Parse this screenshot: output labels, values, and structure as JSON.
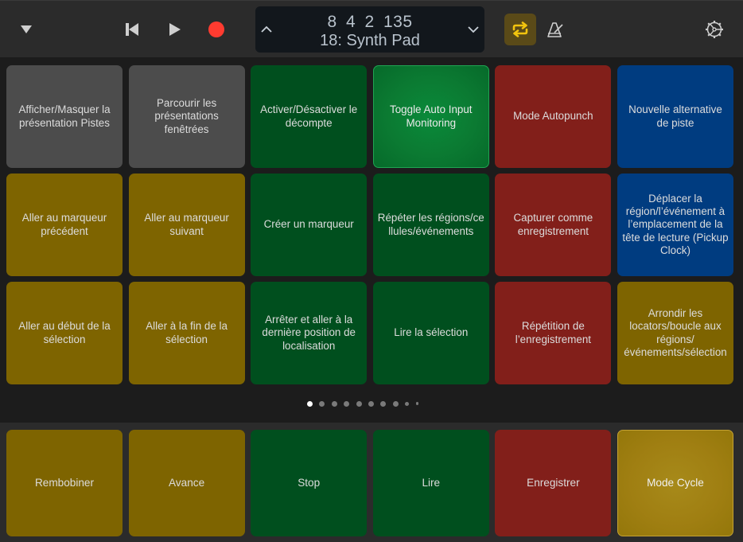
{
  "control_bar": {
    "menu_icon": "triangle-down-icon",
    "transport": {
      "go_to_start_icon": "skip-back-icon",
      "play_icon": "play-icon",
      "record_icon": "record-icon",
      "record_color": "#ff3b30"
    },
    "lcd": {
      "position": "8 4 2 135",
      "track_name": "18: Synth Pad",
      "prev_icon": "chevron-up-icon",
      "next_icon": "chevron-down-icon"
    },
    "cycle": {
      "icon": "cycle-icon",
      "active": true,
      "color": "#f2c40e"
    },
    "metronome_icon": "metronome-icon",
    "settings_icon": "gear-icon"
  },
  "pads": [
    {
      "label": "Afficher/Masquer la présentation Pistes",
      "color": "gray"
    },
    {
      "label": "Parcourir les présentations fenêtrées",
      "color": "gray"
    },
    {
      "label": "Activer/Désactiver le décompte",
      "color": "green"
    },
    {
      "label": "Toggle Auto Input Monitoring",
      "color": "green",
      "active": true
    },
    {
      "label": "Mode Autopunch",
      "color": "red"
    },
    {
      "label": "Nouvelle alternative de piste",
      "color": "blue"
    },
    {
      "label": "Aller au marqueur précédent",
      "color": "yellow"
    },
    {
      "label": "Aller au marqueur suivant",
      "color": "yellow"
    },
    {
      "label": "Créer un marqueur",
      "color": "green"
    },
    {
      "label": "Répéter les régions/cellules/événements",
      "color": "green"
    },
    {
      "label": "Capturer comme enregistrement",
      "color": "red"
    },
    {
      "label": "Déplacer la région/l’événement à l’emplacement de la tête de lecture (Pickup Clock)",
      "color": "blue"
    },
    {
      "label": "Aller au début de la sélection",
      "color": "yellow"
    },
    {
      "label": "Aller à la fin de la sélection",
      "color": "yellow"
    },
    {
      "label": "Arrêter et aller à la dernière position de localisation",
      "color": "green"
    },
    {
      "label": "Lire la sélection",
      "color": "green"
    },
    {
      "label": "Répétition de l’enregistrement",
      "color": "red"
    },
    {
      "label": "Arrondir les locators/boucle aux régions/événements/sélection",
      "color": "yellow"
    }
  ],
  "pager": {
    "page_count": 10,
    "current_page": 1
  },
  "transport_pads": [
    {
      "label": "Rembobiner",
      "color": "yellow"
    },
    {
      "label": "Avance",
      "color": "yellow"
    },
    {
      "label": "Stop",
      "color": "green"
    },
    {
      "label": "Lire",
      "color": "green"
    },
    {
      "label": "Enregistrer",
      "color": "red"
    },
    {
      "label": "Mode Cycle",
      "color": "yellow",
      "active": true
    }
  ],
  "colors": {
    "gray": "#4c4c4c",
    "green": "#004f1e",
    "red": "#821f1a",
    "blue": "#003c80",
    "yellow": "#7e6400"
  }
}
